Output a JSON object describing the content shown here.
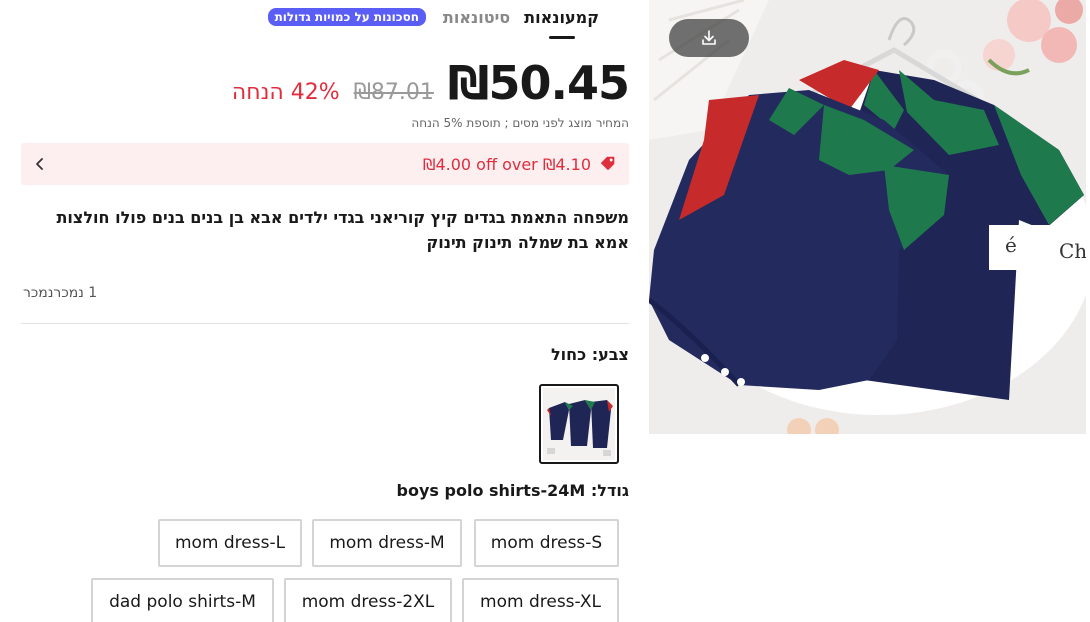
{
  "image_panel": {
    "download_icon": "download-icon",
    "image_text_fragments": [
      "Chi",
      "é"
    ]
  },
  "tabs": [
    {
      "label": "קמעונאות",
      "active": true
    },
    {
      "label": "סיטונאות",
      "active": false
    }
  ],
  "badge": "חסכונות על כמויות גדולות",
  "price": {
    "current": "₪50.45",
    "original": "₪87.01",
    "discount": "42% הנחה",
    "tax_note": "המחיר מוצג לפני מסים ; תוספת 5% הנחה"
  },
  "coupon": {
    "text": "₪4.00 off over ₪4.10",
    "icon": "price-tag-icon",
    "chevron": "chevron-left-icon"
  },
  "product": {
    "title": "משפחה התאמת בגדים קיץ קוריאני בגדי ילדים אבא בן בנים בנים פולו חולצות אמא בת שמלה תינוק תינוק",
    "sold": "1 נמכרנמכר"
  },
  "color": {
    "label": "צבע: כחול"
  },
  "size": {
    "label_prefix": "גודל: ",
    "selected": "boys polo shirts-24M",
    "options": [
      "mom dress-S",
      "mom dress-M",
      "mom dress-L",
      "mom dress-XL",
      "mom dress-2XL",
      "dad polo shirts-M"
    ]
  },
  "colors": {
    "accent_red": "#e02d3c",
    "badge_blue": "#5b5ef5",
    "coupon_bg": "#fdeef0",
    "navy": "#1f2555",
    "green": "#1e7a4c"
  }
}
